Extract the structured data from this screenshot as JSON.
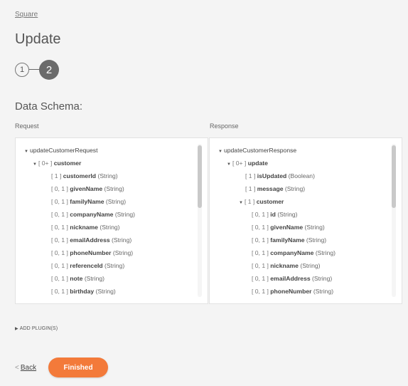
{
  "breadcrumb": "Square",
  "page_title": "Update",
  "stepper": {
    "steps": [
      "1",
      "2"
    ],
    "current": 2
  },
  "section_title": "Data Schema:",
  "request": {
    "label": "Request",
    "rows": [
      {
        "level": 0,
        "caret": "▼",
        "card": "",
        "name": "updateCustomerRequest",
        "type": "",
        "bold": false
      },
      {
        "level": 1,
        "caret": "▼",
        "card": "[ 0+ ]",
        "name": "customer",
        "type": "",
        "bold": true
      },
      {
        "level": 2,
        "caret": "",
        "card": "[ 1 ]",
        "name": "customerId",
        "type": "(String)",
        "bold": true
      },
      {
        "level": 2,
        "caret": "",
        "card": "[ 0, 1 ]",
        "name": "givenName",
        "type": "(String)",
        "bold": true
      },
      {
        "level": 2,
        "caret": "",
        "card": "[ 0, 1 ]",
        "name": "familyName",
        "type": "(String)",
        "bold": true
      },
      {
        "level": 2,
        "caret": "",
        "card": "[ 0, 1 ]",
        "name": "companyName",
        "type": "(String)",
        "bold": true
      },
      {
        "level": 2,
        "caret": "",
        "card": "[ 0, 1 ]",
        "name": "nickname",
        "type": "(String)",
        "bold": true
      },
      {
        "level": 2,
        "caret": "",
        "card": "[ 0, 1 ]",
        "name": "emailAddress",
        "type": "(String)",
        "bold": true
      },
      {
        "level": 2,
        "caret": "",
        "card": "[ 0, 1 ]",
        "name": "phoneNumber",
        "type": "(String)",
        "bold": true
      },
      {
        "level": 2,
        "caret": "",
        "card": "[ 0, 1 ]",
        "name": "referenceId",
        "type": "(String)",
        "bold": true
      },
      {
        "level": 2,
        "caret": "",
        "card": "[ 0, 1 ]",
        "name": "note",
        "type": "(String)",
        "bold": true
      },
      {
        "level": 2,
        "caret": "",
        "card": "[ 0, 1 ]",
        "name": "birthday",
        "type": "(String)",
        "bold": true
      }
    ]
  },
  "response": {
    "label": "Response",
    "rows": [
      {
        "level": 0,
        "caret": "▼",
        "card": "",
        "name": "updateCustomerResponse",
        "type": "",
        "bold": false
      },
      {
        "level": 1,
        "caret": "▼",
        "card": "[ 0+ ]",
        "name": "update",
        "type": "",
        "bold": true
      },
      {
        "level": 2,
        "caret": "",
        "card": "[ 1 ]",
        "name": "isUpdated",
        "type": "(Boolean)",
        "bold": true
      },
      {
        "level": 2,
        "caret": "",
        "card": "[ 1 ]",
        "name": "message",
        "type": "(String)",
        "bold": true
      },
      {
        "level": 2,
        "caret": "▼",
        "card": "[ 1 ]",
        "name": "customer",
        "type": "",
        "bold": true
      },
      {
        "level": 3,
        "caret": "",
        "card": "[ 0, 1 ]",
        "name": "id",
        "type": "(String)",
        "bold": true
      },
      {
        "level": 3,
        "caret": "",
        "card": "[ 0, 1 ]",
        "name": "givenName",
        "type": "(String)",
        "bold": true
      },
      {
        "level": 3,
        "caret": "",
        "card": "[ 0, 1 ]",
        "name": "familyName",
        "type": "(String)",
        "bold": true
      },
      {
        "level": 3,
        "caret": "",
        "card": "[ 0, 1 ]",
        "name": "companyName",
        "type": "(String)",
        "bold": true
      },
      {
        "level": 3,
        "caret": "",
        "card": "[ 0, 1 ]",
        "name": "nickname",
        "type": "(String)",
        "bold": true
      },
      {
        "level": 3,
        "caret": "",
        "card": "[ 0, 1 ]",
        "name": "emailAddress",
        "type": "(String)",
        "bold": true
      },
      {
        "level": 3,
        "caret": "",
        "card": "[ 0, 1 ]",
        "name": "phoneNumber",
        "type": "(String)",
        "bold": true
      }
    ]
  },
  "add_plugin": {
    "icon": "triangle-right-icon",
    "label": "ADD PLUGIN(S)"
  },
  "back": {
    "icon": "chevron-left-icon",
    "chevron": "<",
    "label": "Back"
  },
  "finished": {
    "label": "Finished",
    "color": "#f37a3a"
  }
}
